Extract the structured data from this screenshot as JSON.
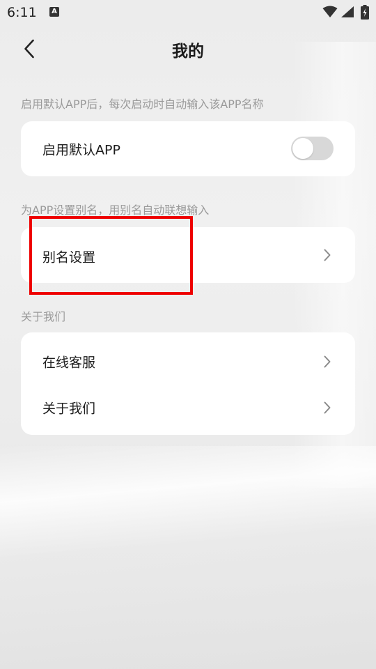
{
  "status_bar": {
    "time": "6:11",
    "notification_icon": "A",
    "icons": [
      "wifi-icon",
      "cellular-signal-icon",
      "battery-icon"
    ]
  },
  "header": {
    "title": "我的",
    "back_icon": "chevron-left-icon"
  },
  "sections": {
    "default_app": {
      "caption": "启用默认APP后，每次启动时自动输入该APP名称",
      "toggle_label": "启用默认APP",
      "toggle_on": false
    },
    "alias": {
      "caption": "为APP设置别名，用别名自动联想输入",
      "item_label": "别名设置"
    },
    "about": {
      "caption": "关于我们",
      "items": [
        {
          "label": "在线客服"
        },
        {
          "label": "关于我们"
        }
      ]
    }
  },
  "colors": {
    "highlight_border": "#ee0000",
    "card_background": "#ffffff",
    "toggle_off": "#d8d8d8",
    "caption_text": "#9a9a9a"
  }
}
